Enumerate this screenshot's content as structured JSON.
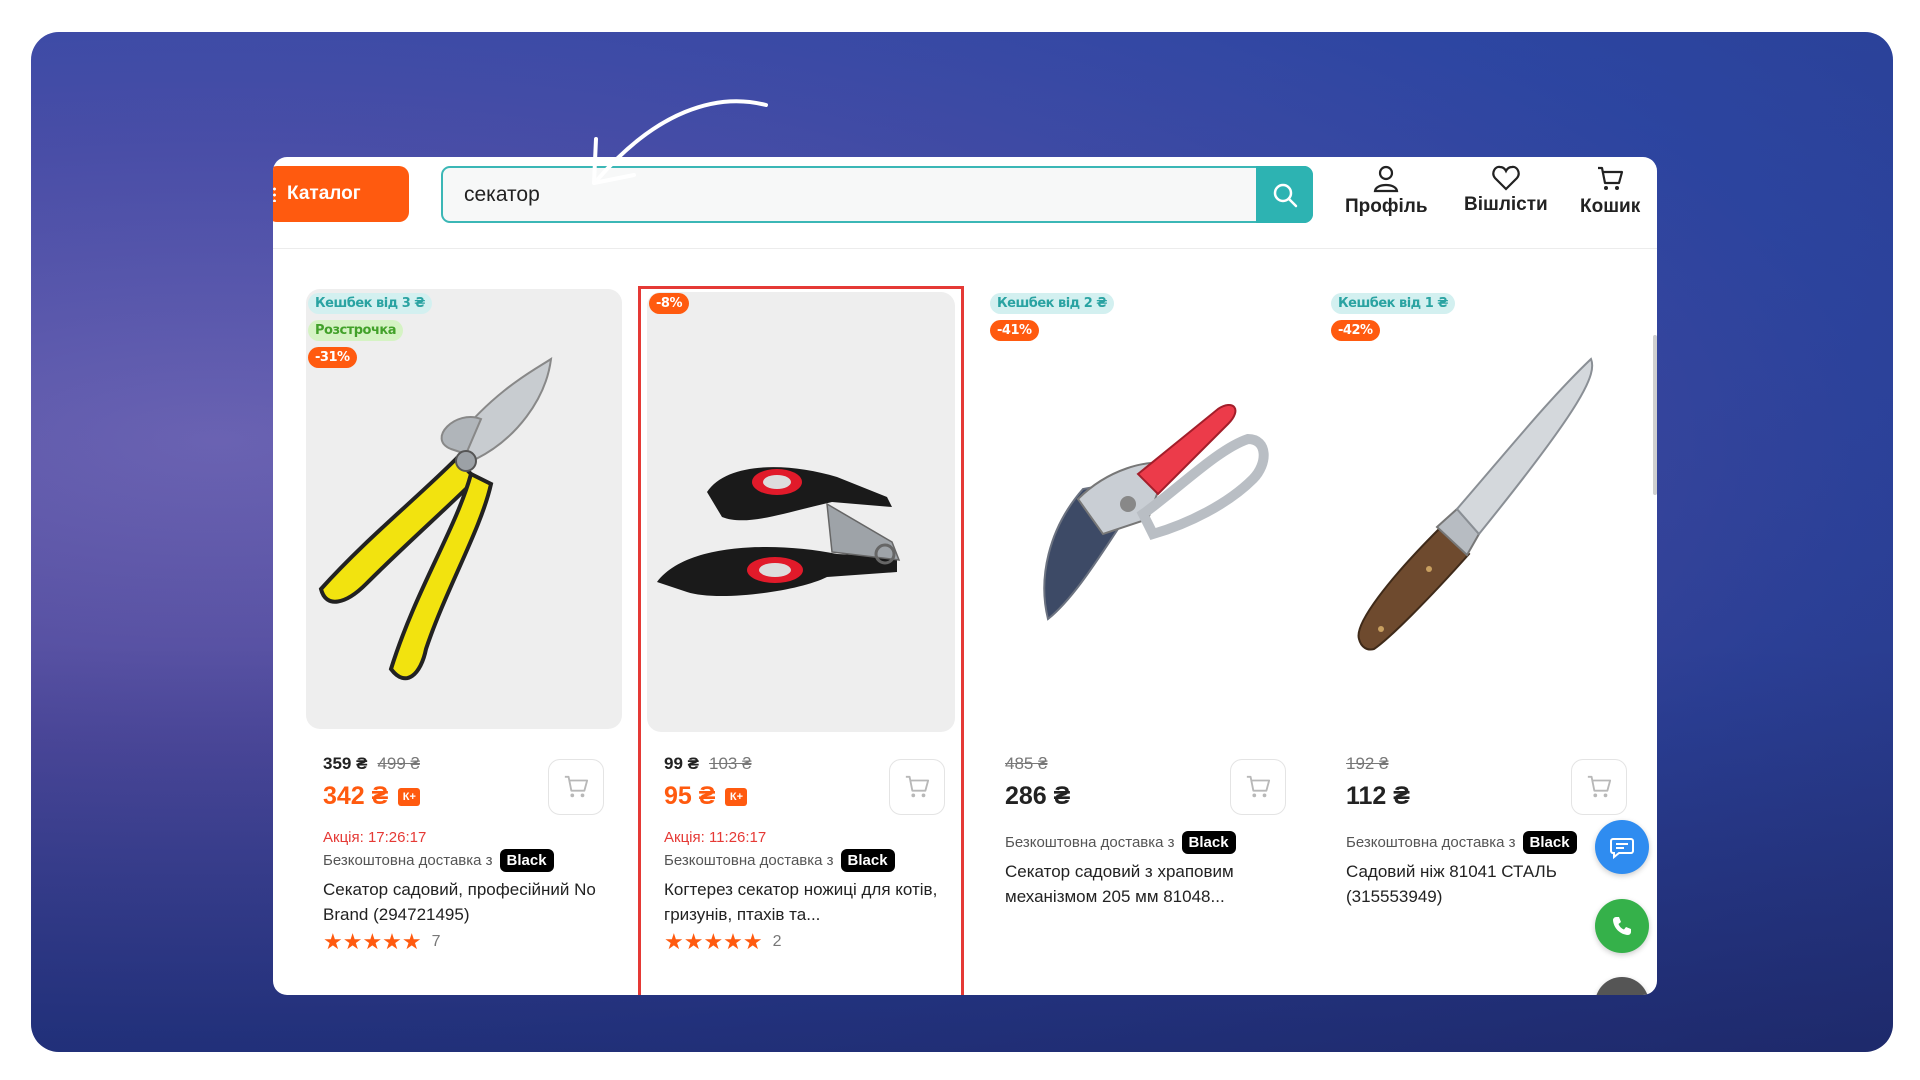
{
  "header": {
    "catalog_label": "Каталог",
    "search_value": "секатор",
    "links": {
      "profile": "Профіль",
      "wishlist": "Вішлісти",
      "cart": "Кошик"
    }
  },
  "products": [
    {
      "badges": {
        "cashback": "Кешбек від 3 ₴",
        "installment": "Розстрочка",
        "discount": "-31%"
      },
      "price": "359 ₴",
      "old_price": "499 ₴",
      "main_price": "342 ₴",
      "promo": "Акція: 17:26:17",
      "delivery": "Безкоштовна доставка з",
      "delivery_tag": "Black",
      "title": "Секатор садовий, професійний No Brand (294721495)",
      "stars": "★★★★★",
      "reviews": "7"
    },
    {
      "badges": {
        "discount": "-8%"
      },
      "price": "99 ₴",
      "old_price": "103 ₴",
      "main_price": "95 ₴",
      "promo": "Акція: 11:26:17",
      "delivery": "Безкоштовна доставка з",
      "delivery_tag": "Black",
      "title": "Когтерез секатор ножиці для котів, гризунів, птахів та...",
      "stars": "★★★★★",
      "reviews": "2"
    },
    {
      "badges": {
        "cashback": "Кешбек від 2 ₴",
        "discount": "-41%"
      },
      "old_price": "485 ₴",
      "main_price": "286 ₴",
      "delivery": "Безкоштовна доставка з",
      "delivery_tag": "Black",
      "title": "Секатор садовий з храповим механізмом 205 мм 81048..."
    },
    {
      "badges": {
        "cashback": "Кешбек від 1 ₴",
        "discount": "-42%"
      },
      "old_price": "192 ₴",
      "main_price": "112 ₴",
      "delivery": "Безкоштовна доставка з",
      "delivery_tag": "Black",
      "title": "Садовий ніж 81041 СТАЛЬ (315553949)"
    }
  ],
  "kplus_label": "К+",
  "colors": {
    "accent": "#ff5a0f",
    "teal": "#2db3b2",
    "highlight": "#e53935",
    "chat": "#2f8cf0",
    "call": "#35b14a"
  },
  "icons": [
    "arrow-annotation-icon",
    "search-icon",
    "profile-icon",
    "heart-icon",
    "cart-icon",
    "chat-icon",
    "phone-icon"
  ]
}
